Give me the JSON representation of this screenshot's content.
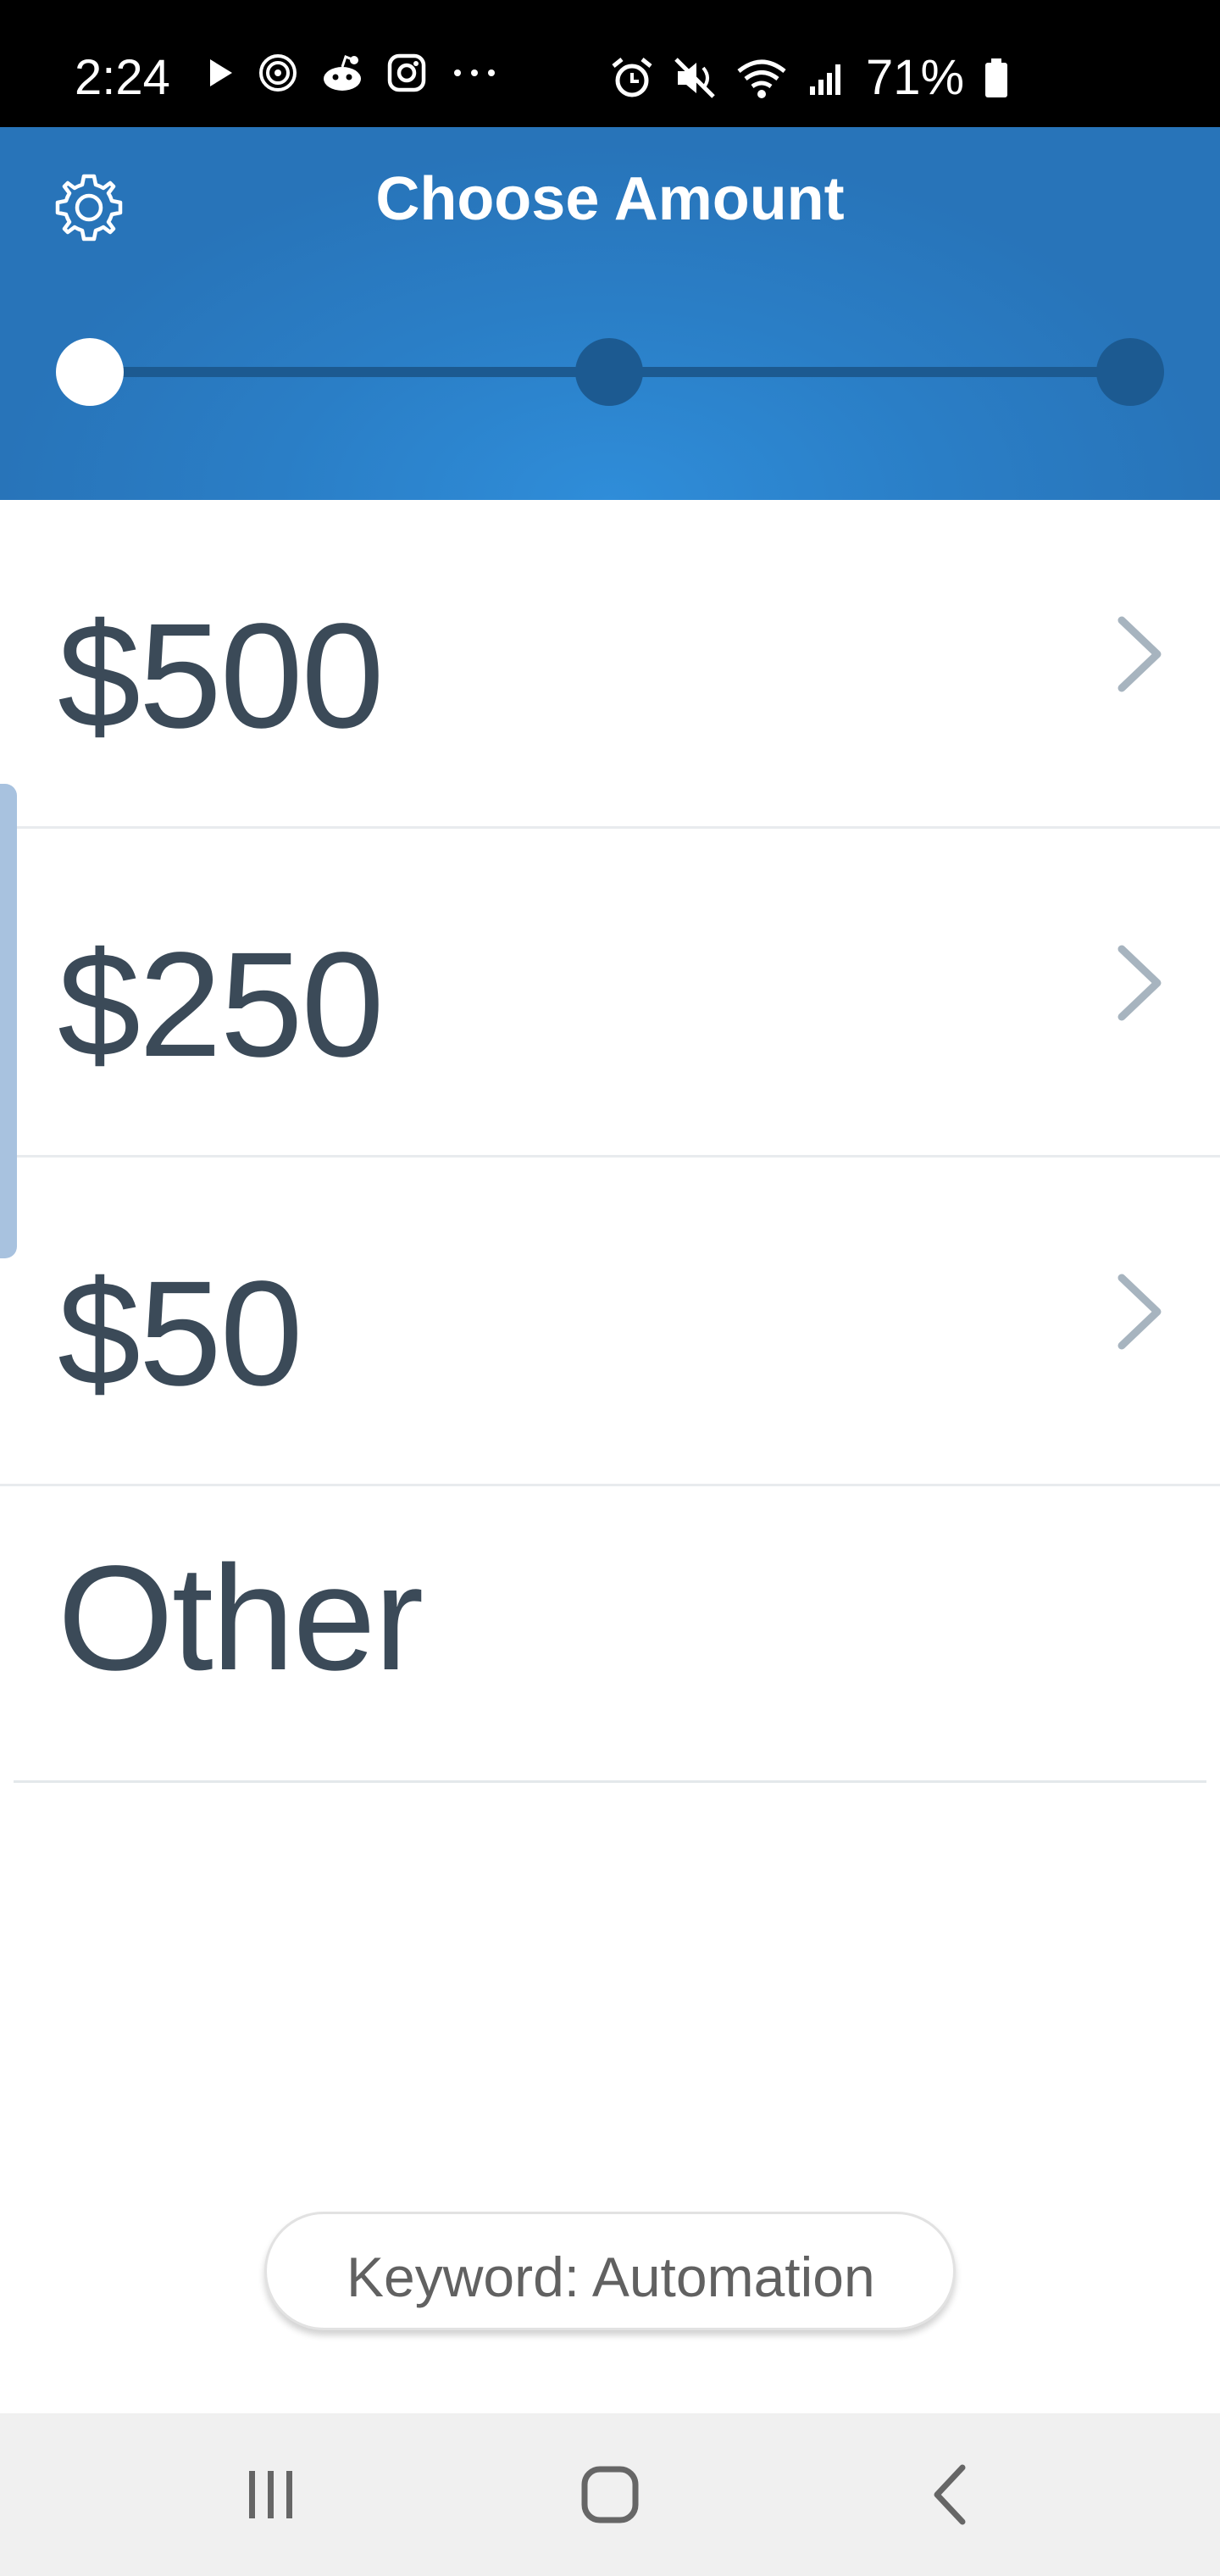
{
  "status_bar": {
    "time": "2:24",
    "battery": "71%",
    "left_icons": [
      "play-icon",
      "threads-icon",
      "reddit-icon",
      "instagram-icon",
      "more-dots-icon"
    ],
    "right_icons": [
      "alarm-icon",
      "mute-icon",
      "wifi-icon",
      "signal-icon",
      "battery-icon"
    ]
  },
  "header": {
    "title": "Choose Amount",
    "settings_icon": "gear-icon",
    "stepper": {
      "total_steps": 3,
      "current_step": 1
    },
    "colors": {
      "background": "#2a7ec6",
      "stepper_inactive": "#1c5a91",
      "stepper_active": "#ffffff"
    }
  },
  "amounts": [
    {
      "label": "$500",
      "has_chevron": true
    },
    {
      "label": "$250",
      "has_chevron": true
    },
    {
      "label": "$50",
      "has_chevron": true
    },
    {
      "label": "Other",
      "has_chevron": false
    }
  ],
  "keyword_chip": {
    "text": "Keyword: Automation"
  },
  "nav_bar": {
    "buttons": [
      "recent-apps-icon",
      "home-icon",
      "back-icon"
    ]
  },
  "colors": {
    "text_primary": "#3b4a58",
    "chevron": "#a7b4bf",
    "divider": "#e8ebee"
  }
}
